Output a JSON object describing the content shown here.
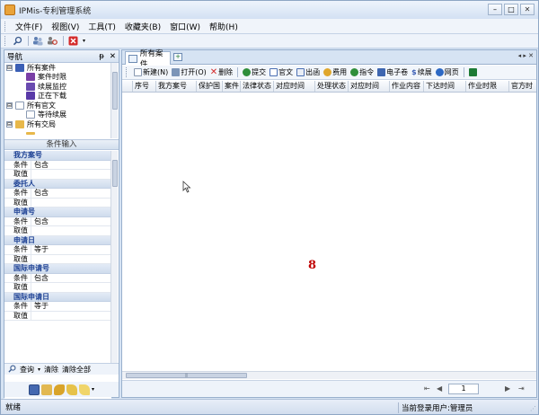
{
  "window": {
    "title": "IPMis-专利管理系统",
    "min": "–",
    "max": "□",
    "close": "✕"
  },
  "menu": [
    "文件(F)",
    "视图(V)",
    "工具(T)",
    "收藏夹(B)",
    "窗口(W)",
    "帮助(H)"
  ],
  "nav": {
    "title": "导航",
    "pin": "ᵽ",
    "close": "✕",
    "tree": [
      {
        "label": "所有案件",
        "level": 0,
        "expand": "⊟",
        "icon_color": "#3b5fb5"
      },
      {
        "label": "案件时限",
        "level": 1,
        "icon_color": "#7a3fa6"
      },
      {
        "label": "续展监控",
        "level": 1,
        "icon_color": "#6a4bb0"
      },
      {
        "label": "正在下载",
        "level": 1,
        "icon_color": "#5a3aa8"
      },
      {
        "label": "所有官文",
        "level": 0,
        "expand": "⊟",
        "icon_color": "#e8b84a"
      },
      {
        "label": "等待续展",
        "level": 1,
        "icon_color": "#8fa6c4"
      },
      {
        "label": "所有交局",
        "level": 0,
        "expand": "⊟",
        "icon_color": "#e8b84a"
      }
    ],
    "conditions_title": "条件输入",
    "condition_groups": [
      {
        "name": "我方案号",
        "rows": [
          [
            "条件",
            "包含"
          ],
          [
            "取值",
            ""
          ]
        ]
      },
      {
        "name": "委托人",
        "rows": [
          [
            "条件",
            "包含"
          ],
          [
            "取值",
            ""
          ]
        ]
      },
      {
        "name": "申请号",
        "rows": [
          [
            "条件",
            "包含"
          ],
          [
            "取值",
            ""
          ]
        ]
      },
      {
        "name": "申请日",
        "rows": [
          [
            "条件",
            "等于"
          ],
          [
            "取值",
            ""
          ]
        ]
      },
      {
        "name": "国际申请号",
        "rows": [
          [
            "条件",
            "包含"
          ],
          [
            "取值",
            ""
          ]
        ]
      },
      {
        "name": "国际申请日",
        "rows": [
          [
            "条件",
            "等于"
          ],
          [
            "取值",
            ""
          ]
        ]
      }
    ],
    "query": {
      "query": "查询",
      "clear": "清除",
      "clear_all": "清除全部"
    }
  },
  "main": {
    "tab": "所有案件",
    "tabnav": "◂ ▸ ✕",
    "toolbar": [
      {
        "label": "新建(N)",
        "color": "#dfe6ef"
      },
      {
        "label": "打开(O)",
        "color": "#7c95b8"
      },
      {
        "label": "删除",
        "color": "#d42b2b"
      },
      {
        "label": "提交",
        "color": "#2f8e3a"
      },
      {
        "label": "官文",
        "color": "#4b6fb3"
      },
      {
        "label": "出函",
        "color": "#4b6fb3"
      },
      {
        "label": "费用",
        "color": "#e0a72c"
      },
      {
        "label": "指令",
        "color": "#2f8e3a"
      },
      {
        "label": "电子卷",
        "color": "#3e66b0"
      },
      {
        "label": "续展",
        "color": "#3b5fb5"
      },
      {
        "label": "网页",
        "color": "#2d69c4"
      },
      {
        "label": "",
        "color": "#1e7b35"
      }
    ],
    "columns": [
      "序号",
      "我方案号",
      "保护国",
      "案件",
      "法律状态",
      "对应时间",
      "处理状态",
      "对应时间",
      "作业内容",
      "下达时间",
      "作业时限",
      "官方时"
    ],
    "badge": "8",
    "pager": {
      "page": "1",
      "prev": "◀",
      "next": "▶",
      "first": "⇤",
      "last": "⇥"
    }
  },
  "status": {
    "left": "就绪",
    "right": "当前登录用户:管理员"
  }
}
